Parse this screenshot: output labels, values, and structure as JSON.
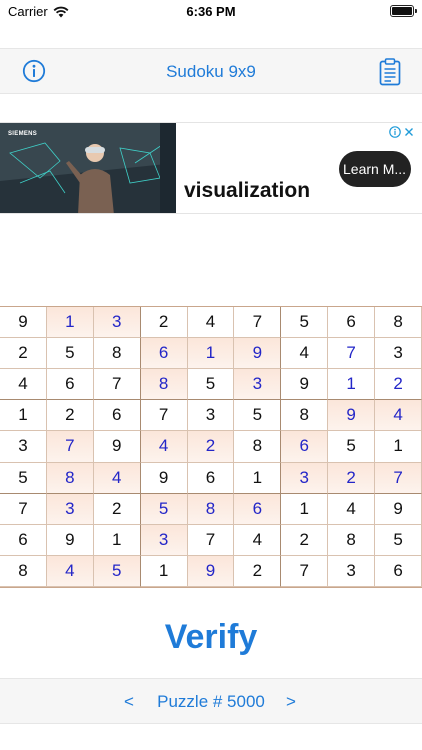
{
  "status_bar": {
    "carrier": "Carrier",
    "time": "6:36 PM",
    "wifi_icon": "wifi-icon",
    "battery_icon": "battery-icon"
  },
  "nav": {
    "title": "Sudoku 9x9",
    "left_icon": "info-icon",
    "right_icon": "clipboard-icon"
  },
  "ad": {
    "brand": "SIEMENS",
    "headline": "visualization",
    "cta": "Learn M...",
    "choices_icons": [
      "adchoices-icon",
      "close-icon"
    ]
  },
  "board": {
    "rows": [
      [
        "9",
        "1",
        "3",
        "2",
        "4",
        "7",
        "5",
        "6",
        "8"
      ],
      [
        "2",
        "5",
        "8",
        "6",
        "1",
        "9",
        "4",
        "7",
        "3"
      ],
      [
        "4",
        "6",
        "7",
        "8",
        "5",
        "3",
        "9",
        "1",
        "2"
      ],
      [
        "1",
        "2",
        "6",
        "7",
        "3",
        "5",
        "8",
        "9",
        "4"
      ],
      [
        "3",
        "7",
        "9",
        "4",
        "2",
        "8",
        "6",
        "5",
        "1"
      ],
      [
        "5",
        "8",
        "4",
        "9",
        "6",
        "1",
        "3",
        "2",
        "7"
      ],
      [
        "7",
        "3",
        "2",
        "5",
        "8",
        "6",
        "1",
        "4",
        "9"
      ],
      [
        "6",
        "9",
        "1",
        "3",
        "7",
        "4",
        "2",
        "8",
        "5"
      ],
      [
        "8",
        "4",
        "5",
        "1",
        "9",
        "2",
        "7",
        "3",
        "6"
      ]
    ],
    "user_entered": [
      [
        0,
        1
      ],
      [
        0,
        2
      ],
      [
        1,
        3
      ],
      [
        1,
        4
      ],
      [
        1,
        5
      ],
      [
        1,
        7
      ],
      [
        2,
        3
      ],
      [
        2,
        5
      ],
      [
        2,
        7
      ],
      [
        2,
        8
      ],
      [
        3,
        7
      ],
      [
        3,
        8
      ],
      [
        4,
        1
      ],
      [
        4,
        3
      ],
      [
        4,
        4
      ],
      [
        4,
        6
      ],
      [
        5,
        1
      ],
      [
        5,
        2
      ],
      [
        5,
        6
      ],
      [
        5,
        7
      ],
      [
        5,
        8
      ],
      [
        6,
        1
      ],
      [
        6,
        3
      ],
      [
        6,
        4
      ],
      [
        6,
        5
      ],
      [
        7,
        3
      ],
      [
        8,
        1
      ],
      [
        8,
        2
      ],
      [
        8,
        4
      ]
    ],
    "user_color": "#2326c8",
    "highlight_color": "#fbe6da"
  },
  "verify_label": "Verify",
  "footer": {
    "prev": "<",
    "puzzle_label": "Puzzle # 5000",
    "next": ">"
  },
  "accent_color": "#1f7bd8"
}
